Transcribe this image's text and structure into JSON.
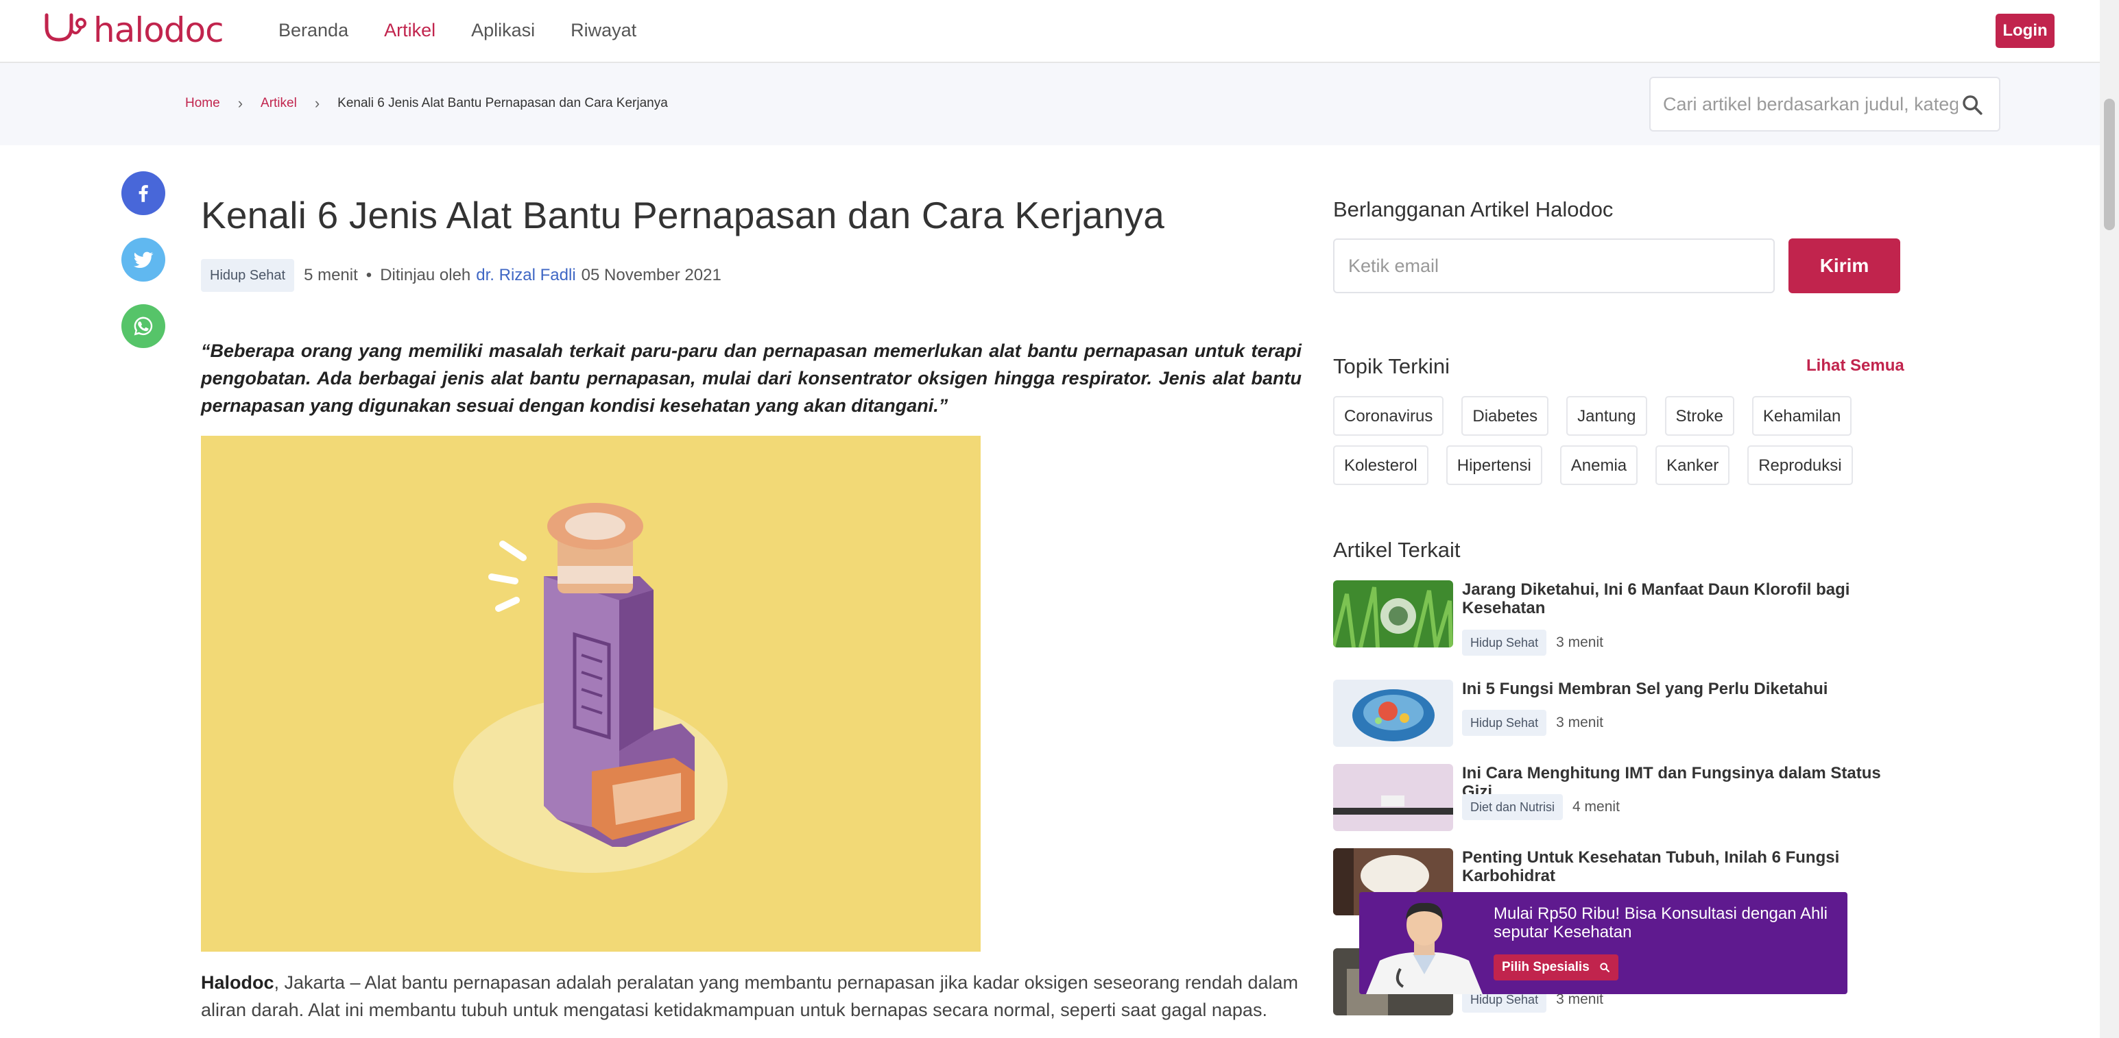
{
  "header": {
    "logo_text": "halodoc",
    "nav": [
      "Beranda",
      "Artikel",
      "Aplikasi",
      "Riwayat"
    ],
    "login_label": "Login"
  },
  "breadcrumb": {
    "home": "Home",
    "section": "Artikel",
    "current": "Kenali 6 Jenis Alat Bantu Pernapasan dan Cara Kerjanya"
  },
  "search": {
    "placeholder": "Cari artikel berdasarkan judul, kategori"
  },
  "article": {
    "title": "Kenali 6 Jenis Alat Bantu Pernapasan dan Cara Kerjanya",
    "tag": "Hidup Sehat",
    "read_time": "5 menit",
    "separator": "•",
    "reviewed_by": "Ditinjau oleh",
    "author": "dr. Rizal Fadli",
    "date": "05 November 2021",
    "quote": "“Beberapa orang yang memiliki masalah terkait paru-paru dan pernapasan memerlukan alat bantu pernapasan untuk terapi pengobatan. Ada berbagai jenis alat bantu pernapasan, mulai dari konsentrator oksigen hingga respirator. Jenis alat bantu pernapasan yang digunakan sesuai dengan kondisi kesehatan yang akan ditangani.”",
    "body_lead": "Halodoc",
    "body_text": ", Jakarta – Alat bantu pernapasan adalah peralatan yang membantu pernapasan jika kadar oksigen seseorang rendah dalam aliran darah. Alat ini membantu tubuh untuk mengatasi ketidakmampuan untuk bernapas secara normal, seperti saat gagal napas."
  },
  "sidebar": {
    "subscribe_title": "Berlangganan Artikel Halodoc",
    "email_placeholder": "Ketik email",
    "send_label": "Kirim",
    "topics_title": "Topik Terkini",
    "see_all": "Lihat Semua",
    "topics_row1": [
      "Coronavirus",
      "Diabetes",
      "Jantung",
      "Stroke",
      "Kehamilan"
    ],
    "topics_row2": [
      "Kolesterol",
      "Hipertensi",
      "Anemia",
      "Kanker",
      "Reproduksi"
    ],
    "related_title": "Artikel Terkait",
    "related": [
      {
        "title": "Jarang Diketahui, Ini 6 Manfaat Daun Klorofil bagi Kesehatan",
        "tag": "Hidup Sehat",
        "time": "3 menit"
      },
      {
        "title": "Ini 5 Fungsi Membran Sel yang Perlu Diketahui",
        "tag": "Hidup Sehat",
        "time": "3 menit"
      },
      {
        "title": "Ini Cara Menghitung IMT dan Fungsinya dalam Status Gizi",
        "tag": "Diet dan Nutrisi",
        "time": "4 menit"
      },
      {
        "title": "Penting Untuk Kesehatan Tubuh, Inilah 6 Fungsi Karbohidrat",
        "tag": "",
        "time": ""
      },
      {
        "title": "",
        "tag": "Hidup Sehat",
        "time": "3 menit"
      }
    ]
  },
  "promo": {
    "text": "Mulai Rp50 Ribu! Bisa Konsultasi dengan Ahli seputar Kesehatan",
    "button": "Pilih Spesialis"
  },
  "colors": {
    "brand": "#c1244d",
    "link_blue": "#3f67c4",
    "promo_purple": "#5f1a8f",
    "hero_bg": "#f2d976"
  }
}
